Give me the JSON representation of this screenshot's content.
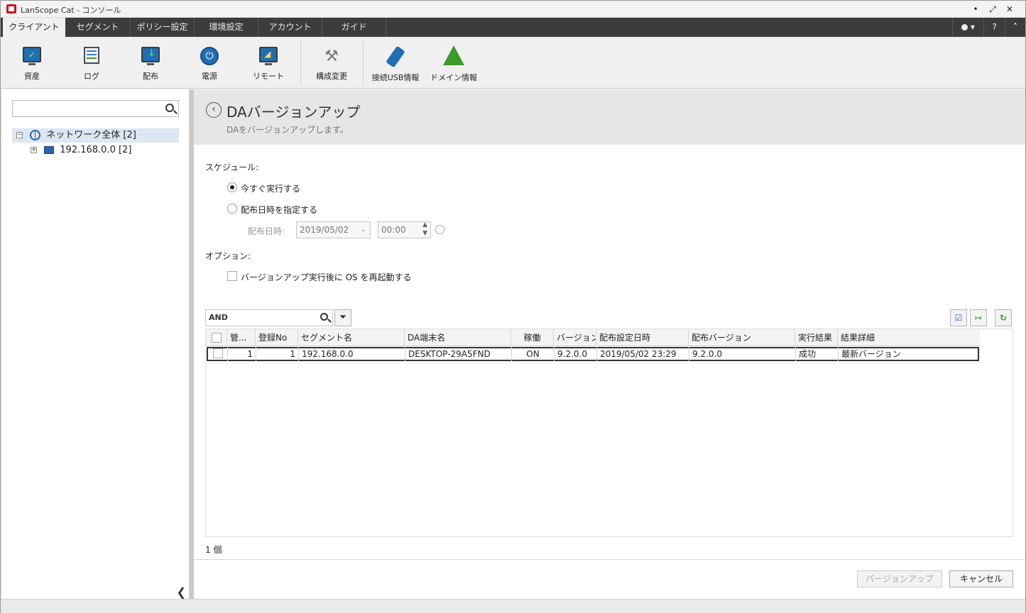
{
  "window": {
    "title": "LanScope Cat - コンソール",
    "minimize": "•",
    "maximize": "⤢",
    "close": "✕"
  },
  "menu": {
    "tabs": [
      {
        "label": "クライアント"
      },
      {
        "label": "セグメント"
      },
      {
        "label": "ポリシー設定"
      },
      {
        "label": "環境設定"
      },
      {
        "label": "アカウント"
      },
      {
        "label": "ガイド"
      }
    ],
    "user_glyph": "▾",
    "help": "?",
    "collapse": "˄"
  },
  "ribbon": {
    "items": [
      {
        "label": "資産"
      },
      {
        "label": "ログ"
      },
      {
        "label": "配布"
      },
      {
        "label": "電源"
      },
      {
        "label": "リモート"
      },
      {
        "label": "構成変更"
      },
      {
        "label": "接続USB情報"
      },
      {
        "label": "ドメイン情報"
      }
    ]
  },
  "sidebar": {
    "search_value": "",
    "tree": [
      {
        "label": "ネットワーク全体 [2]",
        "expander": "−"
      },
      {
        "label": "192.168.0.0 [2]",
        "expander": "+"
      }
    ],
    "collapse_glyph": "❮"
  },
  "page": {
    "back_glyph": "‹",
    "title": "DAバージョンアップ",
    "subtitle": "DAをバージョンアップします。"
  },
  "schedule": {
    "label": "スケジュール:",
    "now": "今すぐ実行する",
    "specify": "配布日時を指定する",
    "datetime_label": "配布日時:",
    "date": "2019/05/02",
    "time": "00:00",
    "selected": "now"
  },
  "options": {
    "label": "オプション:",
    "reboot": "バージョンアップ実行後に OS を再起動する",
    "reboot_checked": false
  },
  "grid": {
    "filter_value": "AND",
    "columns": [
      "管...",
      "登録No",
      "セグメント名",
      "DA端末名",
      "稼働",
      "バージョン",
      "配布設定日時",
      "配布バージョン",
      "実行結果",
      "結果詳細"
    ],
    "rows": [
      {
        "mgmt": "1",
        "reg_no": "1",
        "segment": "192.168.0.0",
        "terminal": "DESKTOP-29A5FND",
        "status": "ON",
        "version": "9.2.0.0",
        "dist_datetime": "2019/05/02 23:29",
        "dist_version": "9.2.0.0",
        "result": "成功",
        "detail": "最新バージョン"
      }
    ],
    "count": "1 個"
  },
  "footer": {
    "upgrade_button": "バージョンアップ",
    "cancel_button": "キャンセル"
  },
  "colors": {
    "menu_bg": "#3c3c3c",
    "header_bg": "#e6e6e6",
    "selection": "#dde6f3",
    "accent_blue": "#1f6fb5",
    "accent_green": "#3a9a2a"
  }
}
